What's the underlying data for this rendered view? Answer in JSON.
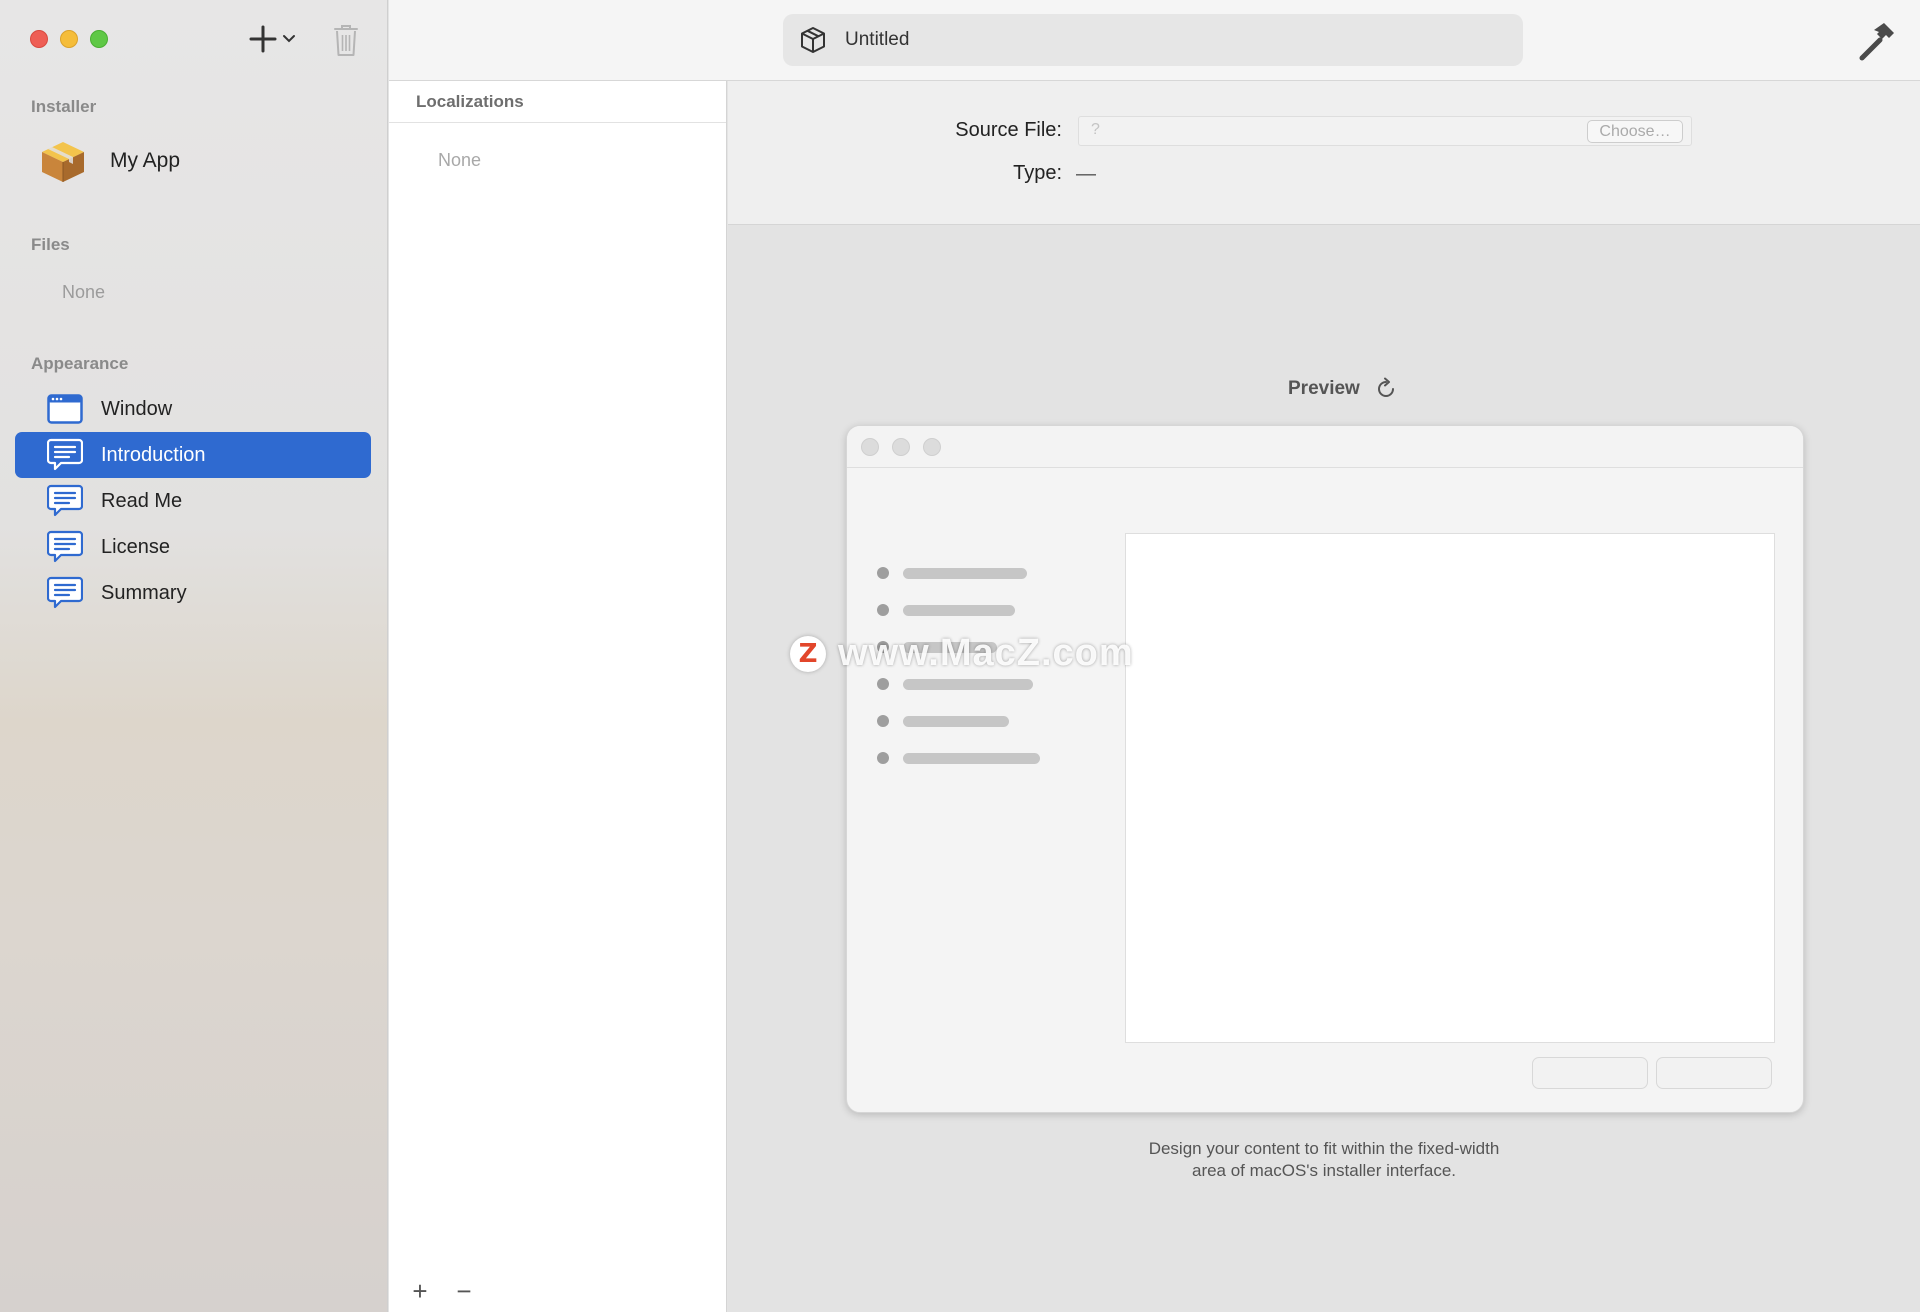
{
  "toolbar": {
    "document_title": "Untitled",
    "title_icon": "package-icon",
    "build_icon": "hammer-icon"
  },
  "sidebar": {
    "add_icon": "plus-icon",
    "trash_icon": "trash-icon",
    "installer": {
      "section_title": "Installer",
      "app_name": "My App",
      "app_icon": "package-icon"
    },
    "files": {
      "section_title": "Files",
      "empty_label": "None"
    },
    "appearance": {
      "section_title": "Appearance",
      "items": [
        {
          "label": "Window",
          "icon": "window-icon",
          "selected": false
        },
        {
          "label": "Introduction",
          "icon": "text-bubble-icon",
          "selected": true
        },
        {
          "label": "Read Me",
          "icon": "text-bubble-icon",
          "selected": false
        },
        {
          "label": "License",
          "icon": "text-bubble-icon",
          "selected": false
        },
        {
          "label": "Summary",
          "icon": "text-bubble-icon",
          "selected": false
        }
      ]
    },
    "selection_color": "#2f6ad0"
  },
  "localizations": {
    "header": "Localizations",
    "empty_label": "None",
    "add_label": "+",
    "remove_label": "−"
  },
  "detail": {
    "source_file_label": "Source File:",
    "source_file_value": "?",
    "choose_button": "Choose…",
    "type_label": "Type:",
    "type_value": "—",
    "preview_title": "Preview",
    "hint_line1": "Design your content to fit within the fixed-width",
    "hint_line2": "area of macOS's installer interface."
  },
  "watermark": {
    "badge": "Z",
    "text": "www.MacZ.com"
  }
}
